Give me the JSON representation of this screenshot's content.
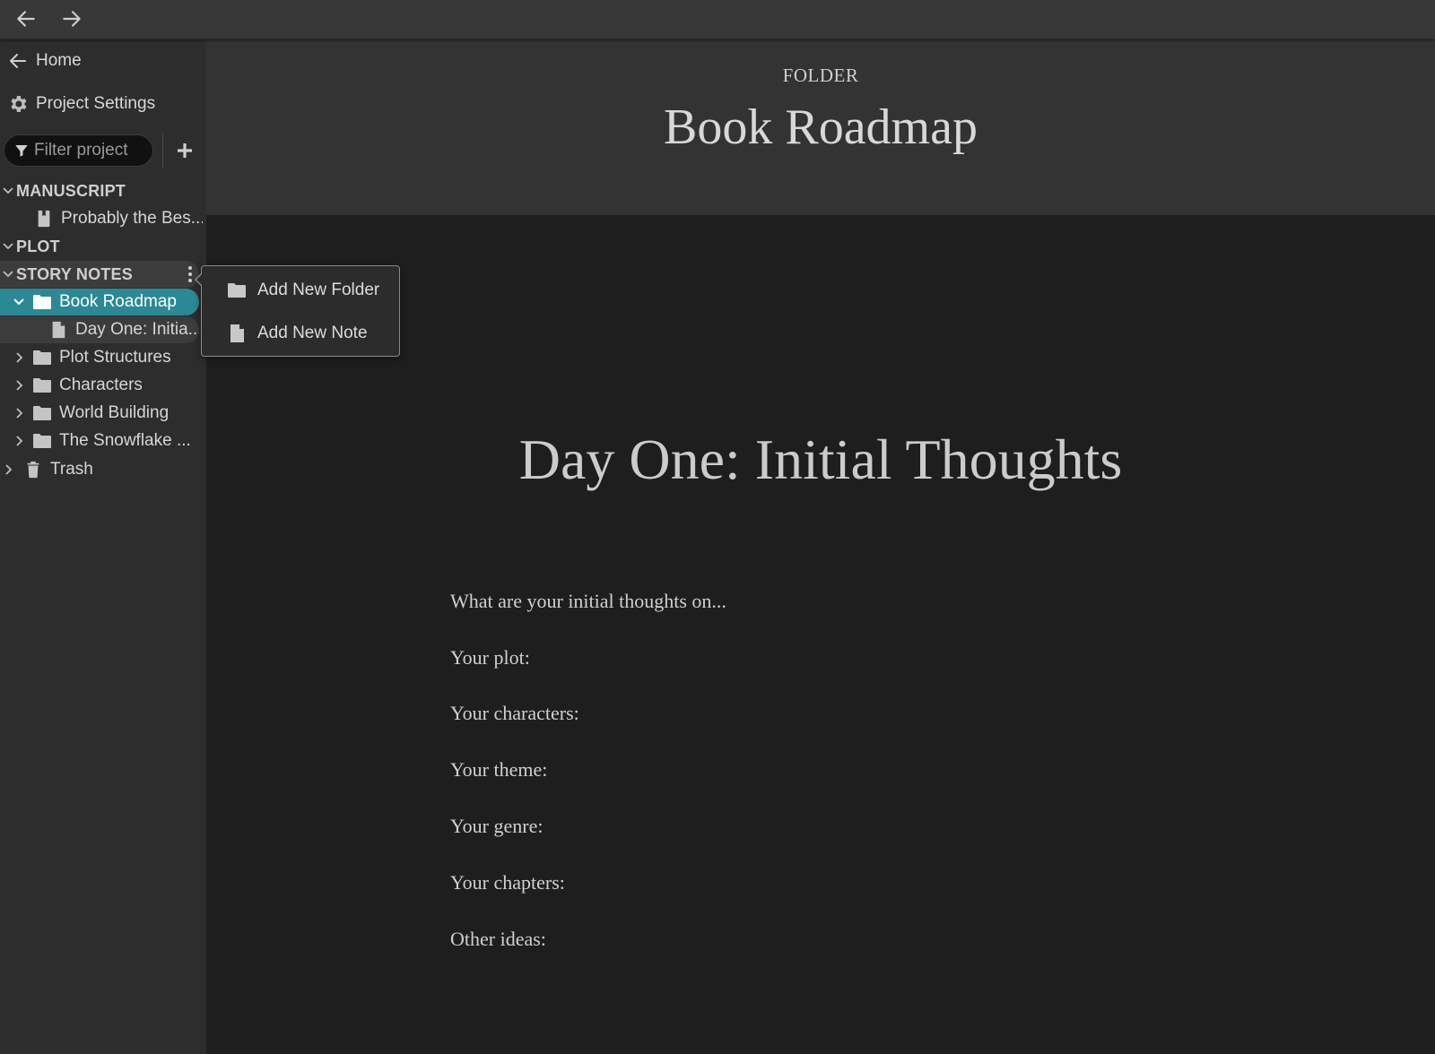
{
  "nav": {
    "back_icon": "arrow-left-icon",
    "forward_icon": "arrow-right-icon"
  },
  "sidebar": {
    "home_label": "Home",
    "settings_label": "Project Settings",
    "filter_placeholder": "Filter project",
    "sections": [
      {
        "label": "MANUSCRIPT",
        "expanded": true
      },
      {
        "label": "PLOT",
        "expanded": true
      },
      {
        "label": "STORY NOTES",
        "expanded": true
      }
    ],
    "manuscript_item": "Probably the Bes...",
    "story_notes": {
      "selected_folder": "Book Roadmap",
      "selected_child": "Day One: Initia...",
      "folders": [
        "Plot Structures",
        "Characters",
        "World Building",
        "The Snowflake ..."
      ]
    },
    "trash_label": "Trash",
    "accent_color": "#2b8996"
  },
  "popup_menu": {
    "items": [
      {
        "label": "Add New Folder",
        "icon": "folder-icon"
      },
      {
        "label": "Add New Note",
        "icon": "file-icon"
      }
    ]
  },
  "header": {
    "kind": "FOLDER",
    "title": "Book Roadmap"
  },
  "note": {
    "title": "Day One: Initial Thoughts",
    "lines": [
      "What are your initial thoughts on...",
      "Your plot:",
      "Your characters:",
      "Your theme:",
      "Your genre:",
      "Your chapters:",
      "Other ideas:"
    ]
  }
}
